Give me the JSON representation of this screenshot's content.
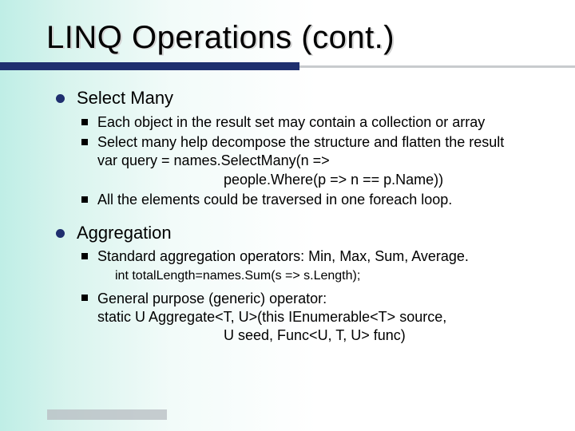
{
  "title": "LINQ Operations (cont.)",
  "sections": [
    {
      "heading": "Select Many",
      "bullets": [
        {
          "text": "Each object in the result set may contain a collection or array"
        },
        {
          "text": "Select many help decompose the structure and flatten the result",
          "cont": [
            "var query = names.SelectMany(n =>",
            "people.Where(p => n == p.Name))"
          ]
        },
        {
          "text": "All the elements could be traversed in one foreach loop."
        }
      ]
    },
    {
      "heading": "Aggregation",
      "bullets": [
        {
          "text": "Standard aggregation operators: Min, Max, Sum, Average.",
          "sub": "int totalLength=names.Sum(s => s.Length);"
        },
        {
          "text": "General purpose (generic) operator:",
          "cont": [
            "static U Aggregate<T, U>(this IEnumerable<T> source,",
            "U seed, Func<U, T, U> func)"
          ]
        }
      ]
    }
  ]
}
